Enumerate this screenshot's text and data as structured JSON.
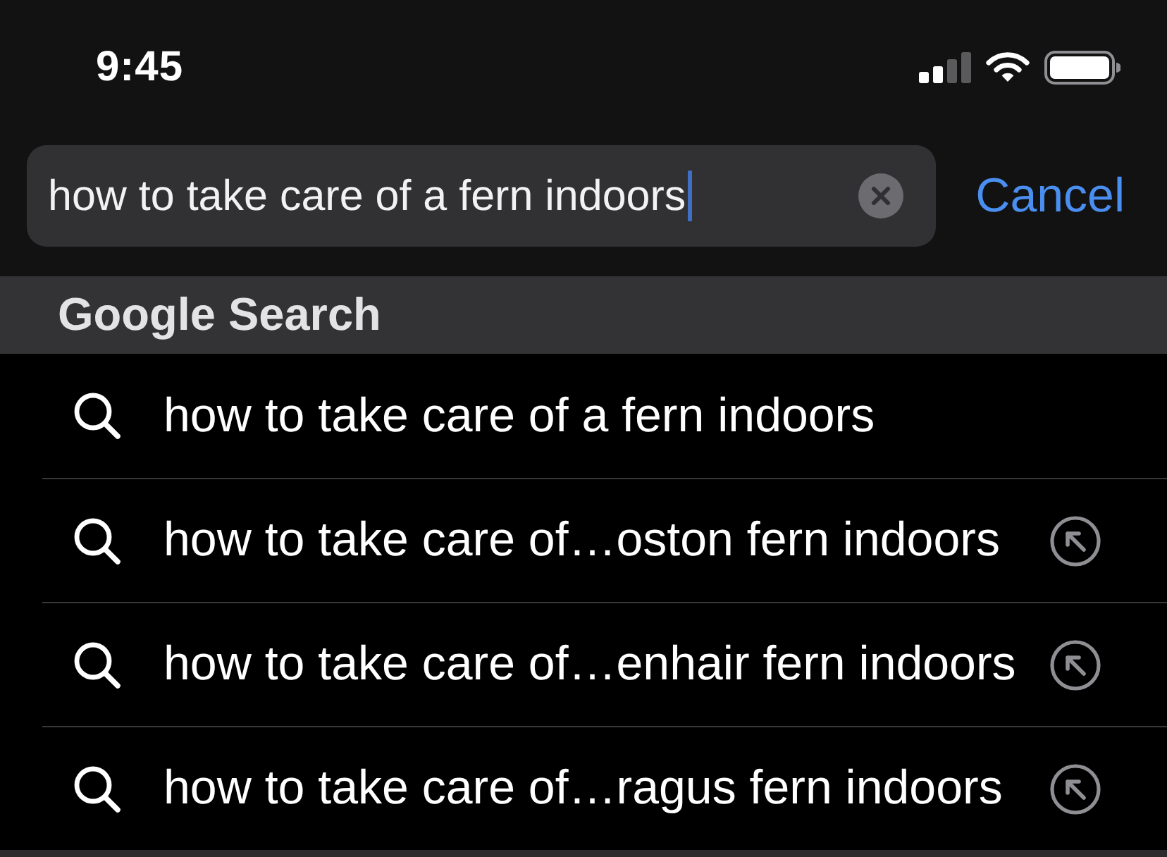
{
  "status_bar": {
    "time": "9:45"
  },
  "search_bar": {
    "value": "how to take care of a fern indoors",
    "focused": true,
    "cancel_label": "Cancel"
  },
  "section_header": {
    "title": "Google Search"
  },
  "suggestions": [
    {
      "text": "how to take care of a fern indoors",
      "fill_button": false
    },
    {
      "text": "how to take care of…oston fern indoors",
      "fill_button": true
    },
    {
      "text": "how to take care of…enhair fern indoors",
      "fill_button": true
    },
    {
      "text": "how to take care of…ragus fern indoors",
      "fill_button": true
    }
  ]
}
